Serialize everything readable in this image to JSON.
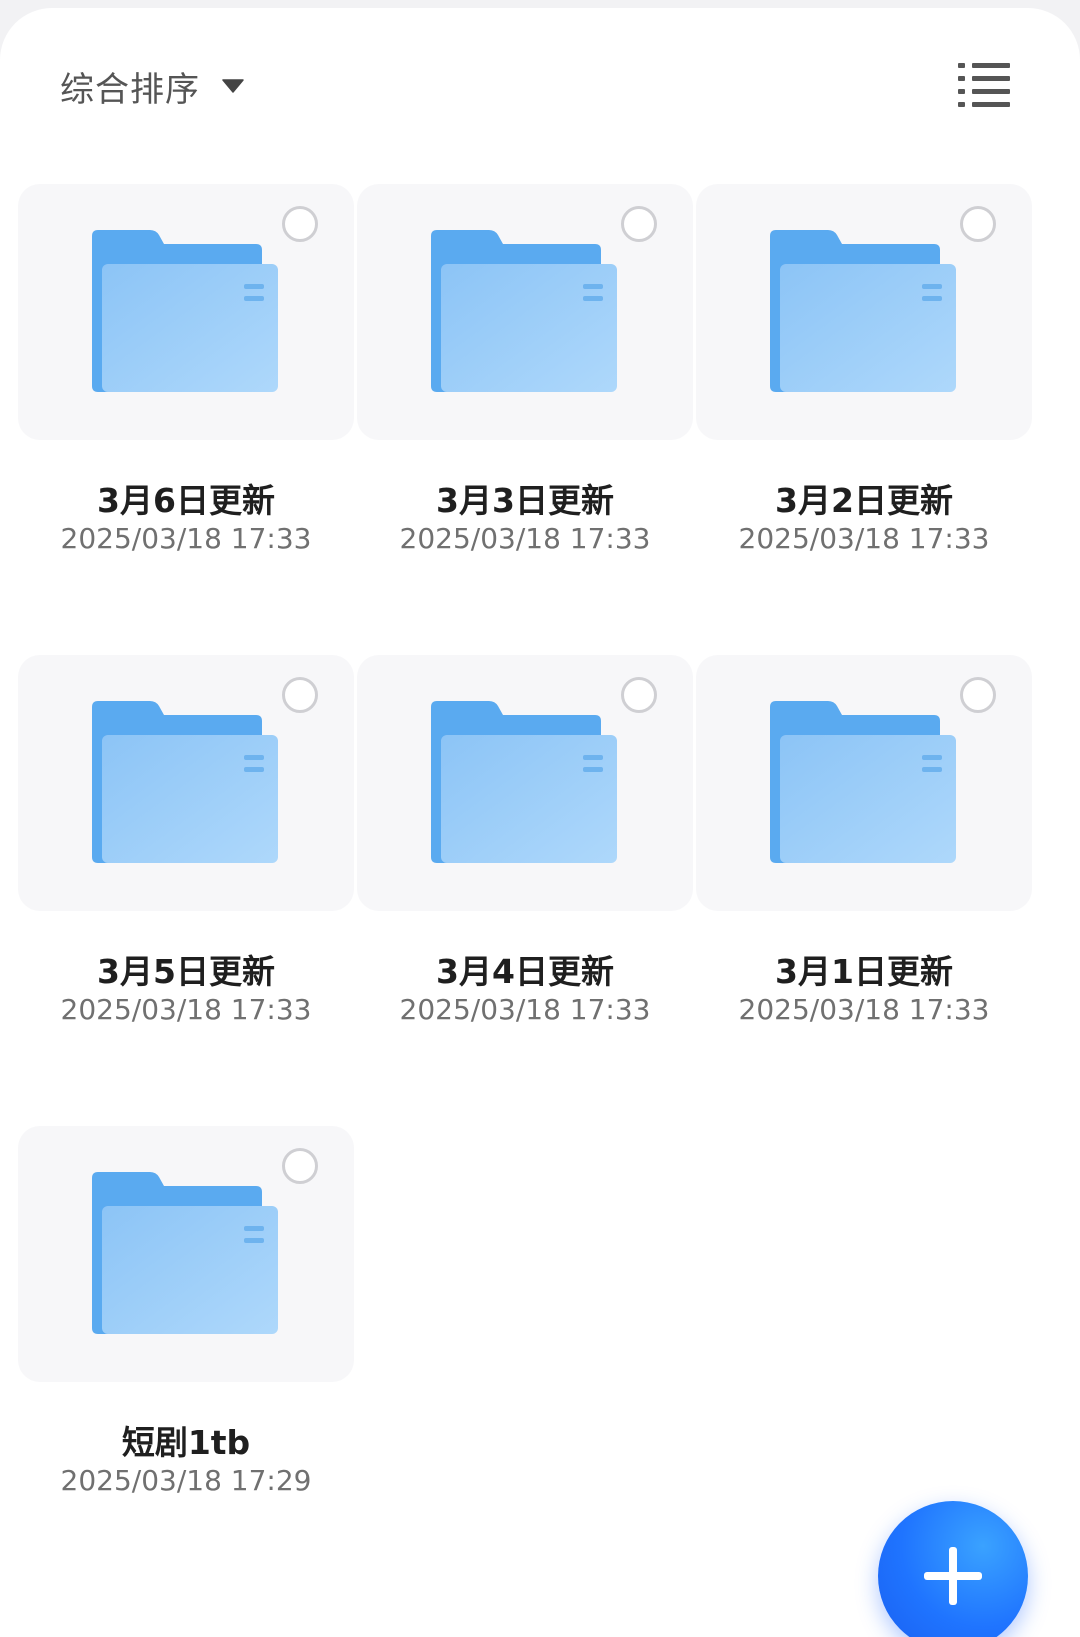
{
  "toolbar": {
    "sort_label": "综合排序",
    "sort_caret_icon": "caret-down-icon",
    "view_toggle_icon": "list-view-icon"
  },
  "folders": [
    {
      "name": "3月6日更新",
      "date": "2025/03/18 17:33"
    },
    {
      "name": "3月3日更新",
      "date": "2025/03/18 17:33"
    },
    {
      "name": "3月2日更新",
      "date": "2025/03/18 17:33"
    },
    {
      "name": "3月5日更新",
      "date": "2025/03/18 17:33"
    },
    {
      "name": "3月4日更新",
      "date": "2025/03/18 17:33"
    },
    {
      "name": "3月1日更新",
      "date": "2025/03/18 17:33"
    },
    {
      "name": "短剧1tb",
      "date": "2025/03/18 17:29"
    }
  ],
  "fab": {
    "icon": "plus-icon",
    "color": "#1f74ff"
  },
  "colors": {
    "folder_back": "#5aaaf0",
    "folder_front": "#9ccdf8",
    "text_primary": "#1f1f1f",
    "text_secondary": "#707070"
  }
}
